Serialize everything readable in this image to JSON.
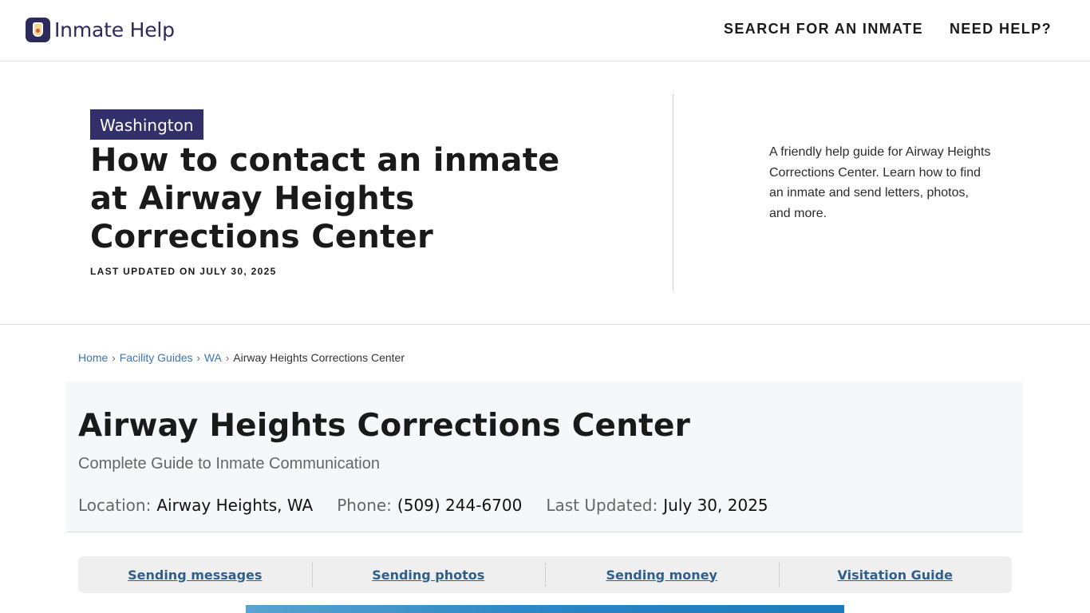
{
  "header": {
    "logo_text": "Inmate Help",
    "nav": [
      {
        "label": "SEARCH FOR AN INMATE"
      },
      {
        "label": "NEED HELP?"
      }
    ]
  },
  "hero": {
    "state_badge": "Washington",
    "title": "How to contact an inmate at Airway Heights Corrections Center",
    "last_updated": "LAST UPDATED ON JULY 30, 2025",
    "description": "A friendly help guide for Airway Heights Corrections Center. Learn how to find an inmate and send letters, photos, and more."
  },
  "breadcrumb": {
    "home": "Home",
    "facility_guides": "Facility Guides",
    "state": "WA",
    "current": "Airway Heights Corrections Center",
    "separator": "›"
  },
  "facility": {
    "title": "Airway Heights Corrections Center",
    "subtitle": "Complete Guide to Inmate Communication",
    "location_label": "Location:",
    "location_value": "Airway Heights, WA",
    "phone_label": "Phone:",
    "phone_value": "(509) 244-6700",
    "updated_label": "Last Updated:",
    "updated_value": "July 30, 2025"
  },
  "tabs": [
    {
      "label": "Sending messages"
    },
    {
      "label": "Sending photos"
    },
    {
      "label": "Sending money"
    },
    {
      "label": "Visitation Guide"
    }
  ],
  "colors": {
    "brand": "#2d2a5c",
    "badge": "#332f6b",
    "link": "#3d74b3",
    "tab_link": "#2f5f8a"
  }
}
